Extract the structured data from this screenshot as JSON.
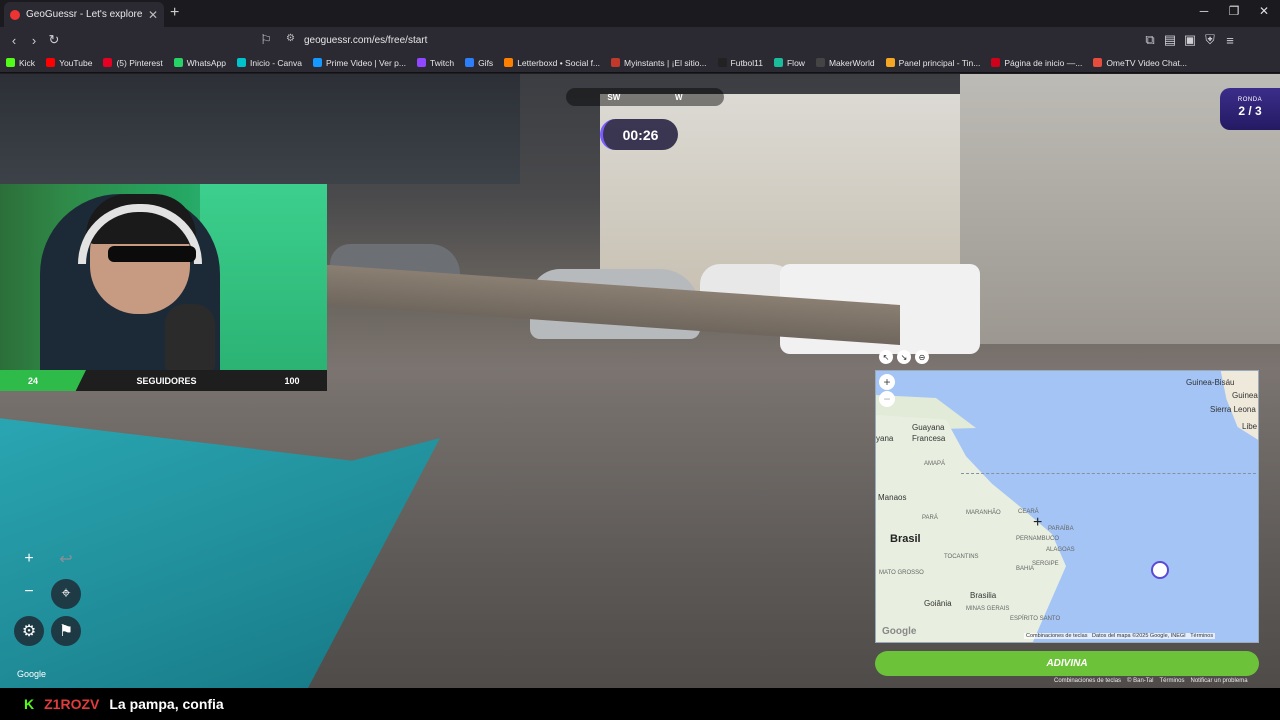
{
  "browser": {
    "tab_title": "GeoGuessr - Let's explore the w",
    "new_tab": "+",
    "url": "geoguessr.com/es/free/start",
    "window_controls": [
      "─",
      "❐",
      "✕"
    ],
    "bookmarks": [
      {
        "label": "Kick",
        "color": "#53fc18"
      },
      {
        "label": "YouTube",
        "color": "#ff0000"
      },
      {
        "label": "(5) Pinterest",
        "color": "#e60023"
      },
      {
        "label": "WhatsApp",
        "color": "#25d366"
      },
      {
        "label": "Inicio - Canva",
        "color": "#00c4cc"
      },
      {
        "label": "Prime Video | Ver p...",
        "color": "#1399ff"
      },
      {
        "label": "Twitch",
        "color": "#9146ff"
      },
      {
        "label": "Gifs",
        "color": "#2d7ff9"
      },
      {
        "label": "Letterboxd • Social f...",
        "color": "#ff8000"
      },
      {
        "label": "Myinstants | ¡El sitio...",
        "color": "#c0392b"
      },
      {
        "label": "Futbol11",
        "color": "#222222"
      },
      {
        "label": "Flow",
        "color": "#1abc9c"
      },
      {
        "label": "MakerWorld",
        "color": "#444444"
      },
      {
        "label": "Panel principal - Tin...",
        "color": "#f5a623"
      },
      {
        "label": "Página de inicio —...",
        "color": "#d0021b"
      },
      {
        "label": "OmeTV Video Chat...",
        "color": "#e74c3c"
      }
    ]
  },
  "game": {
    "compass": [
      "SW",
      "W"
    ],
    "timer": "00:26",
    "round_label": "RONDA",
    "round_value": "2 / 3",
    "guess_button": "ADIVINA",
    "google_watermark": "Google"
  },
  "overlay": {
    "followers_current": "24",
    "followers_label": "SEGUIDORES",
    "followers_goal": "100"
  },
  "map": {
    "labels_large": [
      "Brasil"
    ],
    "labels_medium": [
      "Guayana",
      "Francesa",
      "yana",
      "Manaos",
      "Brasilia",
      "Goiânia",
      "Guinea-Bisáu",
      "Guinea",
      "Sierra Leona",
      "Libe"
    ],
    "labels_small": [
      "AMAPÁ",
      "PARÁ",
      "MARANHÃO",
      "CEARÁ",
      "PARAÍBA",
      "PERNAMBUCO",
      "ALAGOAS",
      "SERGIPE",
      "TOCANTINS",
      "BAHIA",
      "MATO GROSSO",
      "MINAS GERAIS",
      "ESPÍRITO SANTO"
    ],
    "footer": [
      "Combinaciones de teclas",
      "Datos del mapa ©2025 Google, INEGI",
      "Términos"
    ],
    "google_mark": "Google"
  },
  "footer_links": [
    "Combinaciones de teclas",
    "© Ban-Tal",
    "Términos",
    "Notificar un problema"
  ],
  "chat": {
    "platform_icon": "K",
    "username": "Z1ROZV",
    "message": "La pampa, confia"
  }
}
